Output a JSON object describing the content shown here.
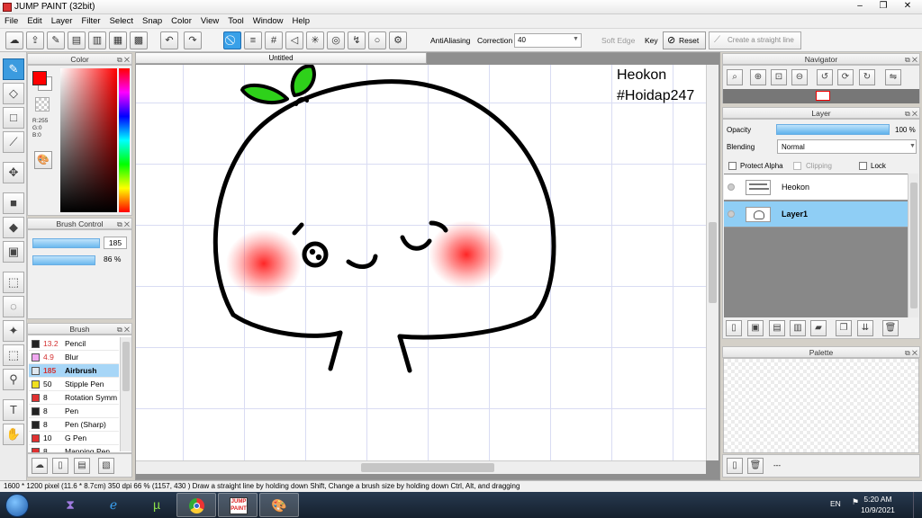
{
  "window": {
    "title": "JUMP PAINT (32bit)",
    "controls": [
      "–",
      "❐",
      "✕"
    ]
  },
  "menu": [
    "File",
    "Edit",
    "Layer",
    "Filter",
    "Select",
    "Snap",
    "Color",
    "View",
    "Tool",
    "Window",
    "Help"
  ],
  "toolbar": {
    "antialiasing_label": "AntiAliasing",
    "correction_label": "Correction",
    "correction_value": "40",
    "soft_edge_label": "Soft Edge",
    "key_label": "Key",
    "reset_label": "Reset",
    "straight_line_label": "Create a straight line"
  },
  "color_panel": {
    "title": "Color",
    "r": "R:255",
    "g": "G:0",
    "b": "B:0",
    "main_color": "#ff0000"
  },
  "brush_control": {
    "title": "Brush Control",
    "size": "185",
    "opacity": "86 %"
  },
  "brush_panel": {
    "title": "Brush",
    "items": [
      {
        "size": "13.2",
        "name": "Pencil",
        "color": "#222222",
        "size_color": "#d33030"
      },
      {
        "size": "4.9",
        "name": "Blur",
        "color": "#f0a8f0",
        "size_color": "#d33030"
      },
      {
        "size": "185",
        "name": "Airbrush",
        "color": "#dfe8f0",
        "size_color": "#d33030",
        "selected": true
      },
      {
        "size": "50",
        "name": "Stipple Pen",
        "color": "#f0e020",
        "size_color": "#000000"
      },
      {
        "size": "8",
        "name": "Rotation Symm",
        "color": "#e03030",
        "size_color": "#000000"
      },
      {
        "size": "8",
        "name": "Pen",
        "color": "#222222",
        "size_color": "#000000"
      },
      {
        "size": "8",
        "name": "Pen (Sharp)",
        "color": "#222222",
        "size_color": "#000000"
      },
      {
        "size": "10",
        "name": "G Pen",
        "color": "#e03030",
        "size_color": "#000000"
      },
      {
        "size": "8",
        "name": "Mapping Pen",
        "color": "#e03030",
        "size_color": "#000000"
      }
    ]
  },
  "document": {
    "tab_title": "Untitled",
    "text_line1": "Heokon",
    "text_line2": "#Hoidap247"
  },
  "navigator": {
    "title": "Navigator"
  },
  "layer_panel": {
    "title": "Layer",
    "opacity_label": "Opacity",
    "opacity_value": "100 %",
    "blending_label": "Blending",
    "blending_value": "Normal",
    "protect_alpha_label": "Protect Alpha",
    "clipping_label": "Clipping",
    "lock_label": "Lock",
    "layers": [
      {
        "name": "Heokon",
        "selected": false
      },
      {
        "name": "Layer1",
        "selected": true
      }
    ]
  },
  "palette": {
    "title": "Palette",
    "dash": "---"
  },
  "status": {
    "text": "1600 * 1200 pixel   (11.6 * 8.7cm)   350 dpi   66 %   (1157, 430 )   Draw a straight line by holding down Shift, Change a brush size by holding down Ctrl, Alt, and dragging"
  },
  "taskbar": {
    "lang": "EN",
    "time": "5:20 AM",
    "date": "10/9/2021"
  }
}
